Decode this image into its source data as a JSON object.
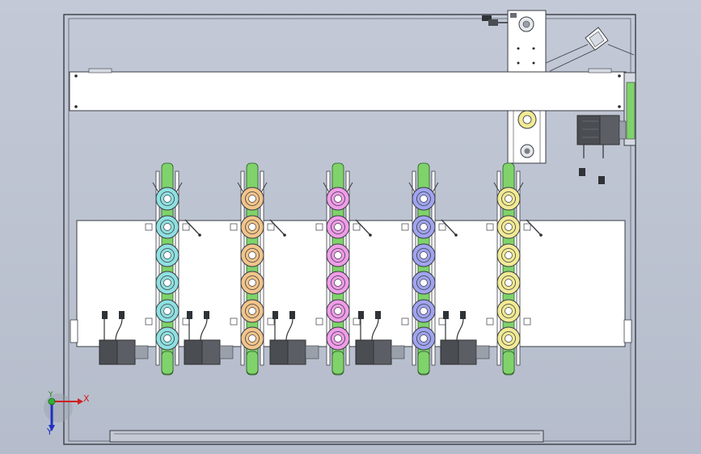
{
  "axes": {
    "x": "X",
    "y": "Y",
    "z": "Y"
  },
  "colors": {
    "background": "#c1c7d4",
    "frame": "#3a3d44",
    "plate": "#ffffff",
    "bolt": "#2b2b2b",
    "track_green": "#7fd36a",
    "motor": "#4a4d52"
  },
  "modules": [
    {
      "name": "cyan-unit",
      "color": "#8fe0e0"
    },
    {
      "name": "tan-unit",
      "color": "#f2c48a"
    },
    {
      "name": "pink-unit",
      "color": "#f09ce8"
    },
    {
      "name": "blue-unit",
      "color": "#a0a4ee"
    },
    {
      "name": "yellow-unit",
      "color": "#f2ea94"
    }
  ],
  "rollers_per_module": 6
}
